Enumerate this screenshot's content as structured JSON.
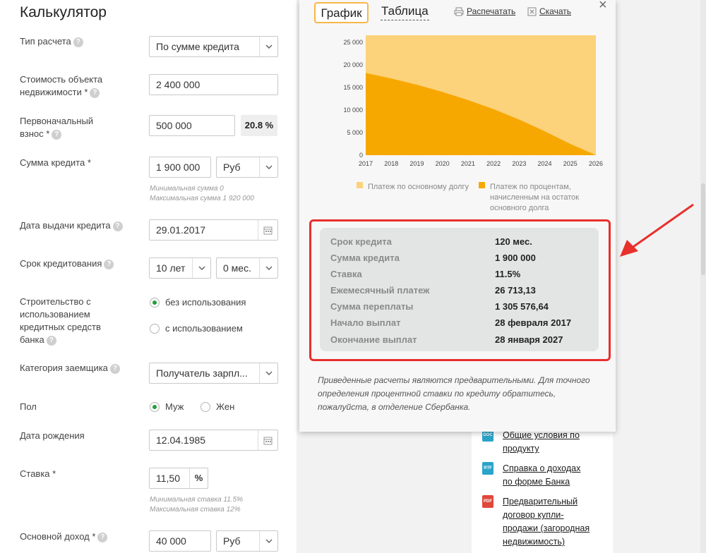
{
  "calculator": {
    "title": "Калькулятор",
    "calc_type": {
      "label": "Тип расчета",
      "value": "По сумме кредита"
    },
    "property_cost": {
      "label": "Стоимость объекта недвижимости *",
      "value": "2 400 000"
    },
    "down_payment": {
      "label": "Первоначальный взнос *",
      "value": "500 000",
      "percent": "20.8 %"
    },
    "loan_amount": {
      "label": "Сумма кредита *",
      "value": "1 900 000",
      "currency": "Руб",
      "min_hint": "Минимальная сумма 0",
      "max_hint": "Максимальная сумма 1 920 000"
    },
    "issue_date": {
      "label": "Дата выдачи кредита",
      "value": "29.01.2017"
    },
    "term": {
      "label": "Срок кредитования",
      "years": "10 лет",
      "months": "0 мес."
    },
    "construction": {
      "label": "Строительство с использованием кредитных средств банка",
      "opt1": "без использования",
      "opt2": "с использованием"
    },
    "category": {
      "label": "Категория заемщика",
      "value": "Получатель зарпл..."
    },
    "gender": {
      "label": "Пол",
      "opt1": "Муж",
      "opt2": "Жен"
    },
    "birth_date": {
      "label": "Дата рождения",
      "value": "12.04.1985"
    },
    "rate": {
      "label": "Ставка *",
      "value": "11,50",
      "suffix": "%",
      "min_hint": "Минимальная ставка 11.5%",
      "max_hint": "Максимальная ставка 12%"
    },
    "income": {
      "label": "Основной доход *",
      "value": "40 000",
      "currency": "Руб"
    }
  },
  "modal": {
    "tabs": {
      "chart": "График",
      "table": "Таблица"
    },
    "print": "Распечатать",
    "download": "Скачать",
    "close": "×",
    "legend": {
      "principal": "Платеж по основному долгу",
      "interest": "Платеж по процентам, начисленным на остаток основного долга"
    },
    "summary": [
      {
        "k": "Срок кредита",
        "v": "120 мес."
      },
      {
        "k": "Сумма кредита",
        "v": "1 900 000"
      },
      {
        "k": "Ставка",
        "v": "11.5%"
      },
      {
        "k": "Ежемесячный платеж",
        "v": "26 713,13"
      },
      {
        "k": "Сумма переплаты",
        "v": "1 305 576,64"
      },
      {
        "k": "Начало выплат",
        "v": "28 февраля 2017"
      },
      {
        "k": "Окончание выплат",
        "v": "28 января 2027"
      }
    ],
    "note": "Приведенные расчеты являются предварительными. Для точного определения процентной ставки по кредиту обратитесь, пожалуйста, в отделение Сбербанка."
  },
  "docs": [
    {
      "icon": "DOC",
      "color": "#2aa3c9",
      "text": "Общие условия по продукту"
    },
    {
      "icon": "RTF",
      "color": "#2aa3c9",
      "text": "Справка о доходах по форме Банка"
    },
    {
      "icon": "PDF",
      "color": "#e0473b",
      "text": "Предварительный договор купли-продажи (загородная недвижимость)"
    }
  ],
  "chart_data": {
    "type": "area",
    "x": [
      "2017",
      "2018",
      "2019",
      "2020",
      "2021",
      "2022",
      "2023",
      "2024",
      "2025",
      "2026"
    ],
    "ylim": [
      0,
      25000
    ],
    "yticks": [
      "25 000",
      "20 000",
      "15 000",
      "10 000",
      "5 000",
      "0"
    ],
    "series": [
      {
        "name": "Платеж по основному долгу",
        "color": "#fcd27a",
        "values": [
          26713,
          26713,
          26713,
          26713,
          26713,
          26713,
          26713,
          26713,
          26713,
          26713
        ]
      },
      {
        "name": "Платеж по процентам, начисленным на остаток основного долга",
        "color": "#f7a800",
        "values": [
          18200,
          17000,
          15600,
          14000,
          12200,
          10200,
          7900,
          5300,
          2500,
          0
        ]
      }
    ]
  }
}
